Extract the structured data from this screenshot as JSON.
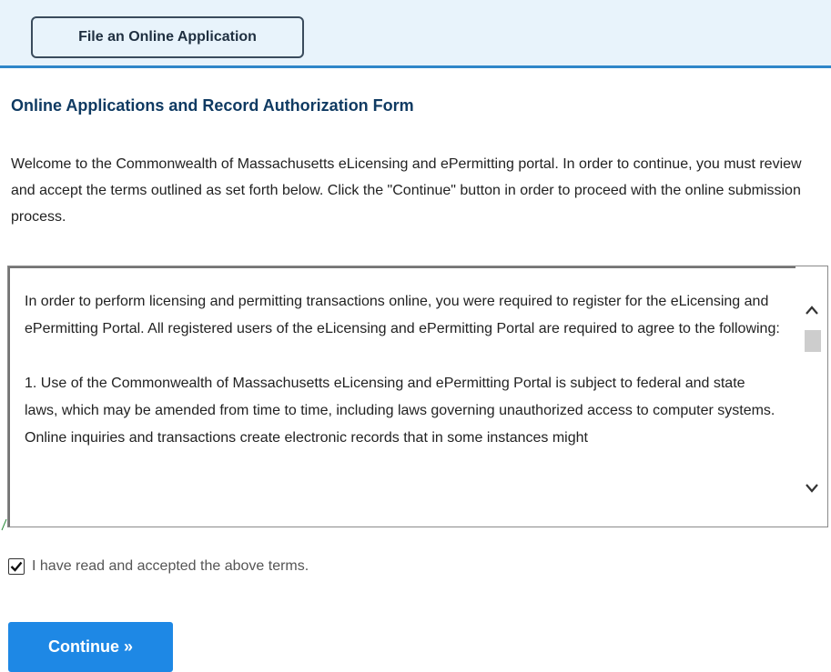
{
  "header": {
    "file_application_label": "File an Online Application"
  },
  "form": {
    "title": "Online Applications and Record Authorization Form",
    "intro": "Welcome to the Commonwealth of Massachusetts eLicensing and ePermitting portal. In order to continue, you must review and accept the terms outlined as set forth below. Click the \"Continue\" button in order to proceed with the online submission process.",
    "terms": {
      "paragraph_1": "In order to perform licensing and permitting transactions online, you were required to register for the eLicensing and ePermitting Portal. All registered users of the eLicensing and ePermitting Portal are required to agree to the following:",
      "paragraph_2": "1. Use of the Commonwealth of Massachusetts eLicensing and ePermitting Portal is subject to federal and state laws, which may be amended from time to time, including laws governing unauthorized access to computer systems. Online inquiries and transactions create electronic records that in some instances might"
    },
    "agree_label": "I have read and accepted the above terms.",
    "agree_checked": true,
    "continue_label": "Continue »"
  },
  "icons": {
    "scroll_up": "chevron-up-icon",
    "scroll_down": "chevron-down-icon",
    "checkmark": "checkmark-icon"
  },
  "colors": {
    "header_background": "#e8f3fb",
    "header_border": "#2f86c9",
    "title": "#0f3a62",
    "continue_button": "#1e88e5"
  }
}
